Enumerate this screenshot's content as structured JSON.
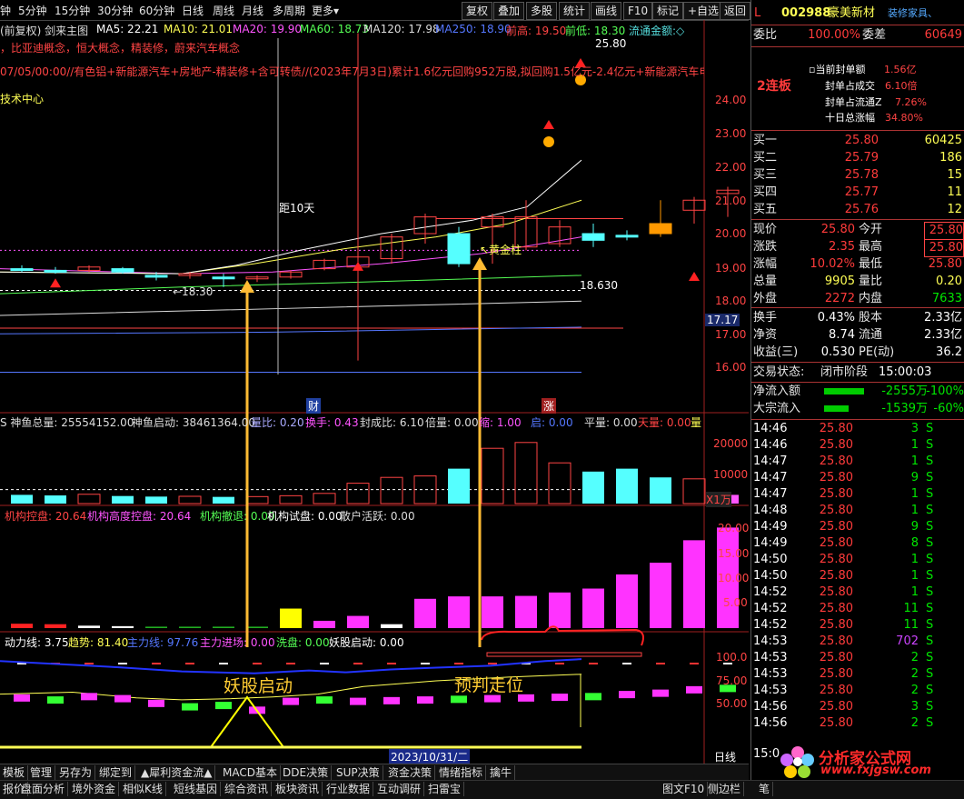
{
  "toolbar": {
    "left_items": [
      "钟",
      "5分钟",
      "15分钟",
      "30分钟",
      "60分钟",
      "日线",
      "周线",
      "月线",
      "多周期",
      "更多"
    ],
    "buttons": [
      "复权",
      "叠加",
      "多股",
      "统计",
      "画线",
      "F10",
      "标记",
      "+自选",
      "返回"
    ]
  },
  "chart": {
    "header_name": "(前复权) 剑来主图",
    "ma": {
      "ma5": "MA5: 22.21",
      "ma10": "MA10: 21.01",
      "ma20": "MA20: 19.90",
      "ma60": "MA60: 18.73",
      "ma120": "MA120: 17.98",
      "ma250": "MA250: 18.90",
      "prev_high": "前高: 19.50",
      "prev_low": "前低: 18.30",
      "flow_amount": "流通金额:◇"
    },
    "concepts": "，比亚迪概念，恒大概念，精装修，蔚来汽车概念",
    "news": "07/05/00:00//有色铝+新能源汽车+房地产-精装修+含可转债//(2023年7月3日)累计1.6亿元回购952万股,拟回购1.5亿元-2.4亿元+新能源汽车电池托架",
    "tech_center": "技术中心",
    "price_ticks": [
      "24.00",
      "23.00",
      "22.00",
      "21.00",
      "20.00",
      "19.00",
      "18.00",
      "17.00",
      "16.00"
    ],
    "current_price_box": "17.17",
    "top_price_label": "25.80",
    "low_price_label": "←18.30",
    "ma_right_label": "18.630",
    "label_10days": "距10天",
    "label_golden": "↖黄金柱",
    "marker_cai": "财",
    "marker_zhang": "涨",
    "vol_header": {
      "a": "S 神鱼总量: 25554152.00",
      "b": "神鱼启动: 38461364.00",
      "c": "量比: 0.20",
      "d": "换手: 0.43",
      "e": "封成比: 6.10",
      "f": "倍量: 0.00",
      "g": "缩: 1.00",
      "h": "启: 0.00",
      "i": "平量: 0.00",
      "j": "天量: 0.00",
      "k": "量"
    },
    "vol_ticks": [
      "20000",
      "10000"
    ],
    "vol_unit": "X1万",
    "inst_header": {
      "a": "机构控盘: 20.64",
      "b": "机构高度控盘: 20.64",
      "c": "机构撤退: 0.00",
      "d": "机构试盘: 0.00",
      "e": "散户活跃: 0.00"
    },
    "inst_ticks": [
      "20.00",
      "15.00",
      "10.00",
      "5.00"
    ],
    "ind_header": {
      "a": "动力线: 3.75",
      "b": "趋势: 81.40",
      "c": "主力线: 97.76",
      "d": "主力进场: 0.00",
      "e": "洗盘: 0.00",
      "f": "妖股启动: 0.00"
    },
    "ind_ticks": [
      "100.0",
      "75.00",
      "50.00"
    ],
    "annot_start": "妖股启动",
    "annot_predict": "预判走位",
    "date_label": "2023/10/31/二",
    "period_label": "日线"
  },
  "chart_data": {
    "type": "candlestick",
    "candles": [
      {
        "o": 18.95,
        "h": 19.05,
        "l": 18.85,
        "c": 18.9,
        "up": false
      },
      {
        "o": 18.9,
        "h": 19.0,
        "l": 18.8,
        "c": 18.85,
        "up": false
      },
      {
        "o": 18.9,
        "h": 19.05,
        "l": 18.85,
        "c": 19.0,
        "up": true
      },
      {
        "o": 18.95,
        "h": 19.0,
        "l": 18.8,
        "c": 18.85,
        "up": false
      },
      {
        "o": 18.75,
        "h": 18.85,
        "l": 18.6,
        "c": 18.7,
        "up": false
      },
      {
        "o": 18.75,
        "h": 18.85,
        "l": 18.65,
        "c": 18.8,
        "up": true
      },
      {
        "o": 18.7,
        "h": 18.8,
        "l": 18.4,
        "c": 18.65,
        "up": false
      },
      {
        "o": 18.65,
        "h": 18.75,
        "l": 18.55,
        "c": 18.7,
        "up": true
      },
      {
        "o": 18.7,
        "h": 18.9,
        "l": 18.65,
        "c": 18.85,
        "up": true
      },
      {
        "o": 18.95,
        "h": 19.25,
        "l": 18.9,
        "c": 19.2,
        "up": true
      },
      {
        "o": 19.0,
        "h": 26.0,
        "l": 16.2,
        "c": 19.3,
        "up": true
      },
      {
        "o": 19.25,
        "h": 20.0,
        "l": 19.1,
        "c": 19.9,
        "up": true
      },
      {
        "o": 20.0,
        "h": 20.6,
        "l": 19.7,
        "c": 20.5,
        "up": true
      },
      {
        "o": 19.1,
        "h": 20.2,
        "l": 19.0,
        "c": 20.0,
        "up": false
      },
      {
        "o": 20.2,
        "h": 20.6,
        "l": 19.1,
        "c": 20.5,
        "up": true
      },
      {
        "o": 19.6,
        "h": 21.0,
        "l": 19.5,
        "c": 20.5,
        "up": true
      },
      {
        "o": 19.7,
        "h": 20.4,
        "l": 19.6,
        "c": 20.2,
        "up": true
      },
      {
        "o": 19.8,
        "h": 20.3,
        "l": 19.6,
        "c": 20.0,
        "up": false
      },
      {
        "o": 19.95,
        "h": 20.1,
        "l": 19.8,
        "c": 19.9,
        "up": false
      },
      {
        "o": 20.3,
        "h": 21.0,
        "l": 19.9,
        "c": 20.0,
        "up": false
      },
      {
        "o": 20.7,
        "h": 21.1,
        "l": 20.3,
        "c": 21.0,
        "up": true
      },
      {
        "o": 21.2,
        "h": 21.4,
        "l": 20.5,
        "c": 21.3,
        "up": true
      }
    ],
    "volume": [
      3000,
      2800,
      3200,
      2600,
      2400,
      2500,
      2300,
      2400,
      2700,
      3500,
      7000,
      9000,
      9500,
      12000,
      19000,
      21000,
      14000,
      11000,
      12000,
      9000,
      8500,
      3000
    ],
    "inst_bars": [
      0.9,
      0.8,
      0.5,
      0.4,
      0.3,
      0.3,
      0.3,
      0.3,
      4.0,
      1.5,
      2.5,
      0.8,
      6.0,
      6.5,
      6.5,
      6.6,
      7.3,
      8.1,
      11.0,
      13.4,
      18.0,
      20.6
    ],
    "ind_blocks": [
      83,
      80,
      85,
      82,
      75,
      70,
      72,
      65,
      78,
      80,
      78,
      79,
      80,
      81,
      82,
      83,
      84,
      85,
      88,
      90,
      95,
      97
    ]
  },
  "stock": {
    "code_prefix": "L",
    "code": "002988",
    "name": "豪美新材",
    "industry": "装修家具、",
    "weibi_label": "委比",
    "weibi": "100.00%",
    "weicha_label": "委差",
    "weicha": "60649",
    "lianban": "2连板",
    "seal_rows": [
      {
        "label": "当前封单额",
        "value": "1.56亿"
      },
      {
        "label": "封单占成交",
        "value": "6.10倍"
      },
      {
        "label": "封单占流通Z",
        "value": "7.26%"
      },
      {
        "label": "十日总涨幅",
        "value": "34.80%"
      }
    ],
    "bids": [
      {
        "label": "买一",
        "price": "25.80",
        "vol": "60425"
      },
      {
        "label": "买二",
        "price": "25.79",
        "vol": "186"
      },
      {
        "label": "买三",
        "price": "25.78",
        "vol": "15"
      },
      {
        "label": "买四",
        "price": "25.77",
        "vol": "11"
      },
      {
        "label": "买五",
        "price": "25.76",
        "vol": "12"
      }
    ],
    "quote_rows": [
      {
        "l1": "现价",
        "v1": "25.80",
        "l2": "今开",
        "v2": "25.80"
      },
      {
        "l1": "涨跌",
        "v1": "2.35",
        "l2": "最高",
        "v2": "25.80"
      },
      {
        "l1": "涨幅",
        "v1": "10.02%",
        "l2": "最低",
        "v2": "25.80"
      },
      {
        "l1": "总量",
        "v1": "9905",
        "l2": "量比",
        "v2": "0.20"
      },
      {
        "l1": "外盘",
        "v1": "2272",
        "l2": "内盘",
        "v2": "7633"
      }
    ],
    "fund_rows": [
      {
        "l1": "换手",
        "v1": "0.43%",
        "l2": "股本",
        "v2": "2.33亿"
      },
      {
        "l1": "净资",
        "v1": "8.74",
        "l2": "流通",
        "v2": "2.33亿"
      },
      {
        "l1": "收益(三)",
        "v1": "0.530",
        "l2": "PE(动)",
        "v2": "36.2"
      }
    ],
    "trade_status_label": "交易状态:",
    "trade_status": "闭市阶段",
    "trade_time": "15:00:03",
    "net_inflow_label": "净流入额",
    "net_inflow": "-2555万",
    "net_inflow_pct": "-100%",
    "block_inflow_label": "大宗流入",
    "block_inflow": "-1539万",
    "block_inflow_pct": "-60%",
    "ticks": [
      {
        "t": "14:46",
        "p": "25.80",
        "v": "3",
        "s": "S"
      },
      {
        "t": "14:46",
        "p": "25.80",
        "v": "1",
        "s": "S"
      },
      {
        "t": "14:47",
        "p": "25.80",
        "v": "1",
        "s": "S"
      },
      {
        "t": "14:47",
        "p": "25.80",
        "v": "9",
        "s": "S"
      },
      {
        "t": "14:47",
        "p": "25.80",
        "v": "1",
        "s": "S"
      },
      {
        "t": "14:48",
        "p": "25.80",
        "v": "1",
        "s": "S"
      },
      {
        "t": "14:49",
        "p": "25.80",
        "v": "9",
        "s": "S"
      },
      {
        "t": "14:49",
        "p": "25.80",
        "v": "8",
        "s": "S"
      },
      {
        "t": "14:50",
        "p": "25.80",
        "v": "1",
        "s": "S"
      },
      {
        "t": "14:50",
        "p": "25.80",
        "v": "1",
        "s": "S"
      },
      {
        "t": "14:52",
        "p": "25.80",
        "v": "1",
        "s": "S"
      },
      {
        "t": "14:52",
        "p": "25.80",
        "v": "11",
        "s": "S"
      },
      {
        "t": "14:52",
        "p": "25.80",
        "v": "11",
        "s": "S"
      },
      {
        "t": "14:53",
        "p": "25.80",
        "v": "702",
        "s": "S"
      },
      {
        "t": "14:53",
        "p": "25.80",
        "v": "2",
        "s": "S"
      },
      {
        "t": "14:53",
        "p": "25.80",
        "v": "2",
        "s": "S"
      },
      {
        "t": "14:53",
        "p": "25.80",
        "v": "2",
        "s": "S"
      },
      {
        "t": "14:56",
        "p": "25.80",
        "v": "3",
        "s": "S"
      },
      {
        "t": "14:56",
        "p": "25.80",
        "v": "2",
        "s": "S"
      }
    ],
    "last_tick_time": "15:0"
  },
  "bottom_tabs1": [
    "模板",
    "管理",
    "另存为",
    "绑定到",
    "▲犀利资金流▲",
    "MACD基本",
    "DDE决策",
    "SUP决策",
    "资金决策",
    "情绪指标",
    "擒牛"
  ],
  "bottom_tabs2": [
    "报价",
    "盘面分析",
    "境外资金",
    "相似K线",
    "短线基因",
    "综合资讯",
    "板块资讯",
    "行业数据",
    "互动调研",
    "扫雷宝"
  ],
  "bottom_right": [
    "图文F10",
    "侧边栏",
    "笔"
  ],
  "watermark": {
    "title": "分析家公式网",
    "url": "www.fxjgsw.com"
  }
}
